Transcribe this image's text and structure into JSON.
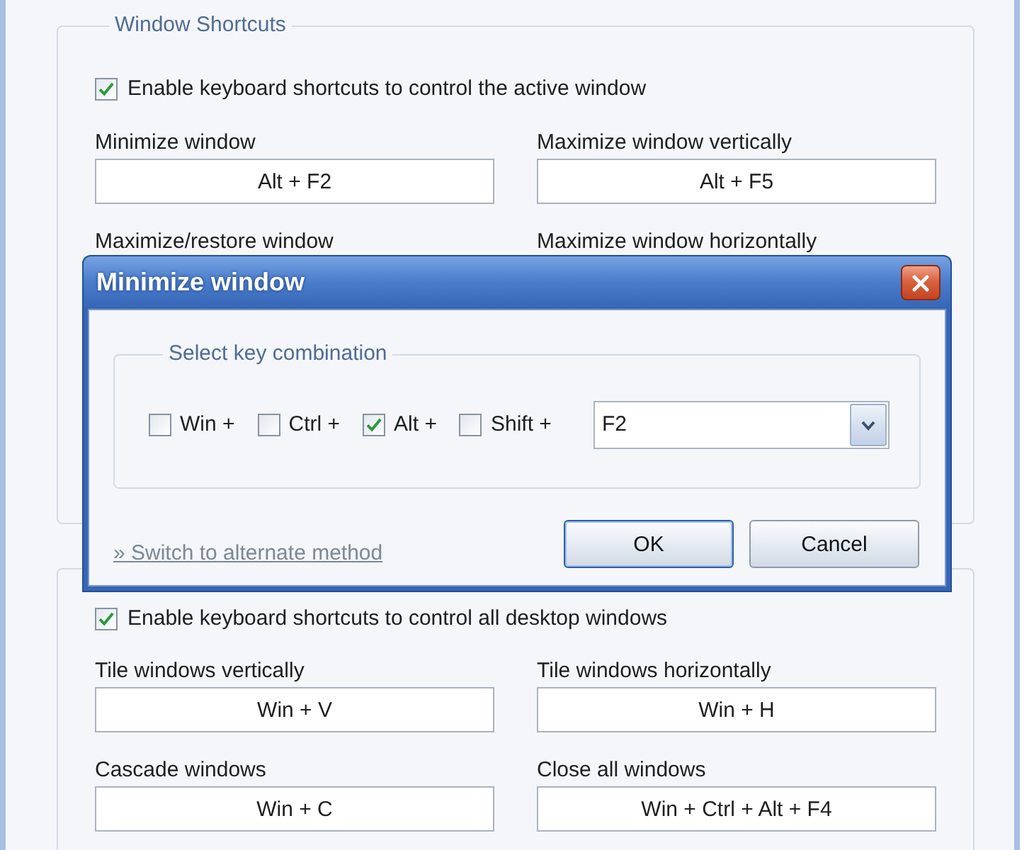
{
  "window_shortcuts": {
    "title": "Window Shortcuts",
    "enable": {
      "label": "Enable keyboard shortcuts to control the active window",
      "checked": true
    },
    "shortcuts": [
      {
        "label": "Minimize window",
        "value": "Alt + F2"
      },
      {
        "label": "Maximize window vertically",
        "value": "Alt + F5"
      },
      {
        "label": "Maximize/restore window"
      },
      {
        "label": "Maximize window horizontally"
      }
    ]
  },
  "desktop_shortcuts": {
    "enable": {
      "label": "Enable keyboard shortcuts to control all desktop windows",
      "checked": true
    },
    "shortcuts": [
      {
        "label": "Tile windows vertically",
        "value": "Win + V"
      },
      {
        "label": "Tile windows horizontally",
        "value": "Win + H"
      },
      {
        "label": "Cascade windows",
        "value": "Win + C"
      },
      {
        "label": "Close all windows",
        "value": "Win + Ctrl + Alt + F4"
      }
    ]
  },
  "dialog": {
    "title": "Minimize window",
    "key_group": {
      "title": "Select key combination",
      "modifiers": [
        {
          "label": "Win +",
          "checked": false
        },
        {
          "label": "Ctrl +",
          "checked": false
        },
        {
          "label": "Alt +",
          "checked": true
        },
        {
          "label": "Shift +",
          "checked": false
        }
      ],
      "key": {
        "value": "F2"
      }
    },
    "link": "» Switch to alternate method",
    "buttons": [
      {
        "label": "OK",
        "default": true
      },
      {
        "label": "Cancel",
        "default": false
      }
    ]
  }
}
